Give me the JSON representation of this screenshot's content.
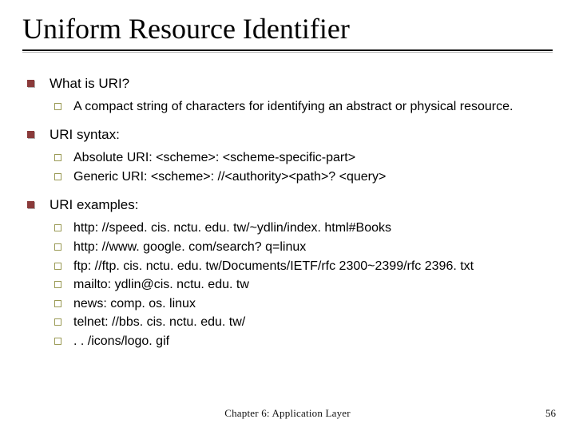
{
  "title": "Uniform Resource Identifier",
  "sections": [
    {
      "heading": "What is URI?",
      "items": [
        "A compact string of characters for identifying an abstract or physical resource."
      ]
    },
    {
      "heading": "URI syntax:",
      "items": [
        "Absolute URI: <scheme>: <scheme-specific-part>",
        "Generic URI: <scheme>: //<authority><path>? <query>"
      ]
    },
    {
      "heading": "URI examples:",
      "items": [
        "http: //speed. cis. nctu. edu. tw/~ydlin/index. html#Books",
        "http: //www. google. com/search? q=linux",
        "ftp: //ftp. cis. nctu. edu. tw/Documents/IETF/rfc 2300~2399/rfc 2396. txt",
        "mailto: ydlin@cis. nctu. edu. tw",
        "news: comp. os. linux",
        "telnet: //bbs. cis. nctu. edu. tw/",
        ". . /icons/logo. gif"
      ]
    }
  ],
  "footer": {
    "center": "Chapter 6: Application Layer",
    "page": "56"
  }
}
